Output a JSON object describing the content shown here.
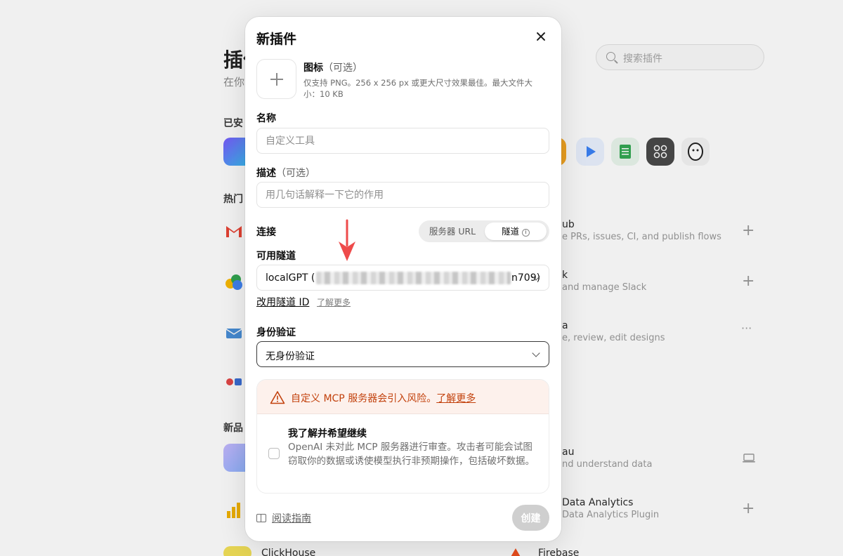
{
  "background": {
    "page_title": "插件",
    "page_subtitle": "在你",
    "search_placeholder": "搜索插件",
    "sections": {
      "installed": "已安",
      "popular": "热门",
      "new": "新品"
    },
    "rows": [
      {
        "title": "ub",
        "subtitle": "e PRs, issues, CI, and publish flows",
        "action": "+"
      },
      {
        "title": "k",
        "subtitle": "and manage Slack",
        "action": "+"
      },
      {
        "title": "a",
        "subtitle": "e, review, edit designs",
        "action": "···"
      },
      {
        "title": "au",
        "subtitle": "nd understand data",
        "action": "laptop-icon"
      },
      {
        "title": "Data Analytics",
        "subtitle": "Data Analytics Plugin",
        "action": "+"
      },
      {
        "title": "Firebase",
        "subtitle": "",
        "action": ""
      }
    ],
    "clickhouse_label": "ClickHouse"
  },
  "modal": {
    "title": "新插件",
    "icon_field": {
      "label": "图标",
      "optional": "（可选）",
      "hint": "仅支持 PNG。256 x 256 px 或更大尺寸效果最佳。最大文件大小：10 KB"
    },
    "name_field": {
      "label": "名称",
      "placeholder": "自定义工具",
      "value": ""
    },
    "description_field": {
      "label": "描述",
      "optional": "（可选）",
      "placeholder": "用几句话解释一下它的作用",
      "value": ""
    },
    "connection": {
      "label": "连接",
      "options": [
        "服务器 URL",
        "隧道"
      ],
      "selected": "隧道"
    },
    "tunnel": {
      "label": "可用隧道",
      "value_prefix": "localGPT (",
      "value_suffix": "n709)",
      "change_link": "改用隧道 ID",
      "learn_more": "了解更多"
    },
    "auth": {
      "label": "身份验证",
      "value": "无身份验证"
    },
    "warning": {
      "text": "自定义 MCP 服务器会引入风险。",
      "link": "了解更多",
      "ack_title": "我了解并希望继续",
      "ack_body": "OpenAI 未对此 MCP 服务器进行审查。攻击者可能会试图窃取你的数据或诱使模型执行非预期操作，包括破坏数据。",
      "checked": false,
      "accent_color": "#c2410c"
    },
    "footer": {
      "guide": "阅读指南",
      "create": "创建"
    }
  },
  "colors": {
    "annotation_arrow": "#ee4b4b",
    "disabled_button": "#cfcfcf"
  }
}
